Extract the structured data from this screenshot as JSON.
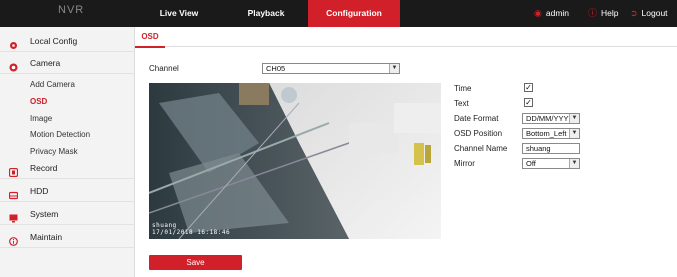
{
  "topbar": {
    "logo": "NVR",
    "tabs": [
      {
        "label": "Live View"
      },
      {
        "label": "Playback"
      },
      {
        "label": "Configuration"
      }
    ],
    "user": "admin",
    "help": "Help",
    "logout": "Logout",
    "accent_color": "#d2202a"
  },
  "sidebar": {
    "groups": [
      {
        "label": "Local Config",
        "icon": "gear-icon"
      },
      {
        "label": "Camera",
        "icon": "camera-icon"
      },
      {
        "label": "Record",
        "icon": "record-icon"
      },
      {
        "label": "HDD",
        "icon": "hdd-icon"
      },
      {
        "label": "System",
        "icon": "monitor-icon"
      },
      {
        "label": "Maintain",
        "icon": "info-icon"
      }
    ],
    "camera_items": [
      {
        "label": "Add Camera"
      },
      {
        "label": "OSD"
      },
      {
        "label": "Image"
      },
      {
        "label": "Motion Detection"
      },
      {
        "label": "Privacy Mask"
      }
    ],
    "active_item": "OSD"
  },
  "main": {
    "tab": "OSD",
    "channel_label": "Channel",
    "channel_value": "CH05",
    "osd_overlay": {
      "name": "shuang",
      "time": "17/01/2018 16:18:46"
    },
    "settings": {
      "time_label": "Time",
      "time_checked": true,
      "text_label": "Text",
      "text_checked": true,
      "date_format_label": "Date Format",
      "date_format_value": "DD/MM/YYYY",
      "osd_position_label": "OSD Position",
      "osd_position_value": "Bottom_Left",
      "channel_name_label": "Channel Name",
      "channel_name_value": "shuang",
      "mirror_label": "Mirror",
      "mirror_value": "Off"
    },
    "save_label": "Save"
  }
}
